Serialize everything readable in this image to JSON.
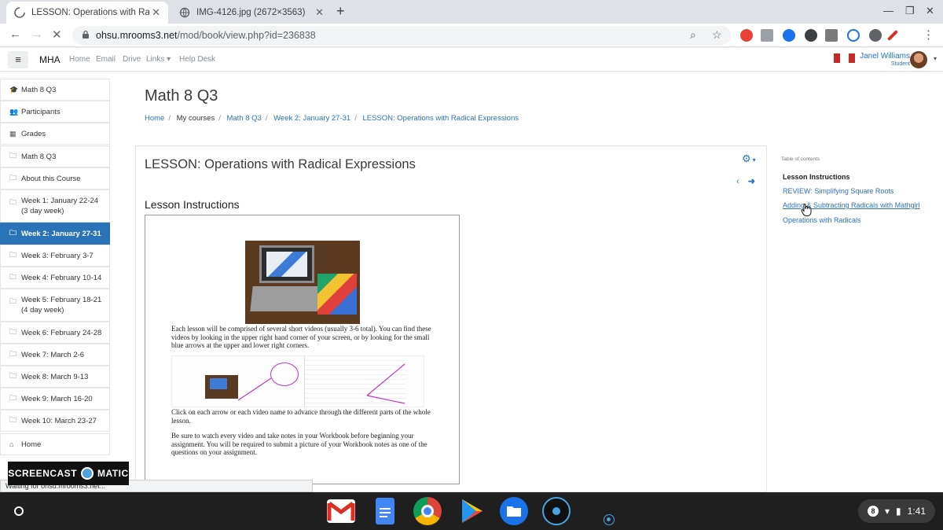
{
  "browser": {
    "tabs": [
      {
        "title": "LESSON: Operations with Radical",
        "active": true
      },
      {
        "title": "IMG-4126.jpg (2672×3563)",
        "active": false
      }
    ],
    "url_host": "ohsu.mrooms3.net",
    "url_path": "/mod/book/view.php?id=236838",
    "status_text": "Waiting for ohsu.mrooms3.net..."
  },
  "navbar": {
    "brand": "MHA",
    "links": [
      "Home",
      "Email",
      "Drive",
      "Links ▾",
      "Help Desk"
    ],
    "user_name": "Janel Williams",
    "user_role": "Student"
  },
  "sidebar": {
    "items": [
      {
        "label": "Math 8 Q3",
        "icon": "mortarboard-icon",
        "active": false
      },
      {
        "label": "Participants",
        "icon": "users-icon",
        "active": false
      },
      {
        "label": "Grades",
        "icon": "table-icon",
        "active": false
      },
      {
        "label": "Math 8 Q3",
        "icon": "folder-icon",
        "active": false
      },
      {
        "label": "About this Course",
        "icon": "folder-icon",
        "active": false
      },
      {
        "label": "Week 1: January 22-24 (3 day week)",
        "icon": "folder-icon",
        "active": false
      },
      {
        "label": "Week 2: January 27-31",
        "icon": "folder-icon",
        "active": true
      },
      {
        "label": "Week 3: February 3-7",
        "icon": "folder-icon",
        "active": false
      },
      {
        "label": "Week 4: February 10-14",
        "icon": "folder-icon",
        "active": false
      },
      {
        "label": "Week 5: February 18-21 (4 day week)",
        "icon": "folder-icon",
        "active": false
      },
      {
        "label": "Week 6: February 24-28",
        "icon": "folder-icon",
        "active": false
      },
      {
        "label": "Week 7: March 2-6",
        "icon": "folder-icon",
        "active": false
      },
      {
        "label": "Week 8: March 9-13",
        "icon": "folder-icon",
        "active": false
      },
      {
        "label": "Week 9: March 16-20",
        "icon": "folder-icon",
        "active": false
      },
      {
        "label": "Week 10: March 23-27",
        "icon": "folder-icon",
        "active": false
      },
      {
        "label": "Home",
        "icon": "home-icon",
        "active": false
      }
    ]
  },
  "header": {
    "course_title": "Math 8 Q3",
    "breadcrumb": [
      "Home",
      "My courses",
      "Math 8 Q3",
      "Week 2: January 27-31",
      "LESSON: Operations with Radical Expressions"
    ]
  },
  "main": {
    "lesson_title": "LESSON: Operations with Radical Expressions",
    "chapter_title": "Lesson Instructions",
    "para1": "Each lesson will be comprised of several short videos (usually 3-6 total).  You can find these videos by looking in the upper right hand corner of your screen, or by looking for the small blue arrows at the upper and lower right corners.",
    "para2": "Click on each arrow or each video name to advance through the different parts of the whole lesson.",
    "para3": "Be sure to watch every video and take notes in your Workbook before beginning your assignment.  You will be required to submit a picture of your Workbook notes as one of the questions on your assignment."
  },
  "toc": {
    "label": "Table of contents",
    "items": [
      {
        "label": "Lesson Instructions",
        "current": true
      },
      {
        "label": "REVIEW: Simplifying Square Roots",
        "current": false
      },
      {
        "label": "Adding & Subtracting Radicals with Mathgirl",
        "current": false
      },
      {
        "label": "Operations with Radicals",
        "current": false
      }
    ]
  },
  "overlay": {
    "left": "SCREENCAST",
    "right": "MATIC"
  },
  "system": {
    "time": "1:41",
    "notification_count": "8"
  },
  "colors": {
    "accent": "#2a73b8",
    "shelf": "#1f1f1f"
  }
}
